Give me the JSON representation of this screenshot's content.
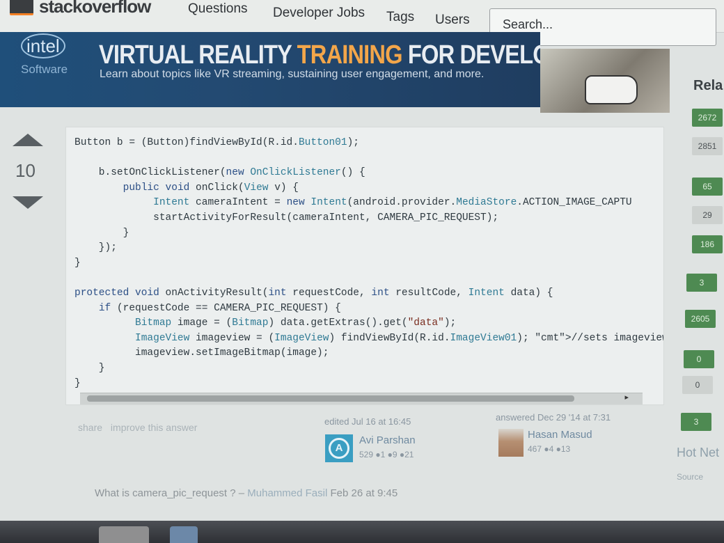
{
  "site": {
    "logo_text": "stackoverflow"
  },
  "nav": {
    "items": [
      "Questions",
      "Developer Jobs",
      "Tags",
      "Users"
    ],
    "search_placeholder": "Search..."
  },
  "banner": {
    "brand": "intel",
    "brand_sub": "Software",
    "title_part1": "VIRTUAL REALITY ",
    "title_accent": "TRAINING",
    "title_part2": " FOR DEVELOPERS",
    "subtitle": "Learn about topics like VR streaming, sustaining user engagement, and more."
  },
  "answer": {
    "vote_count": "10",
    "code_lines": [
      "Button b = (Button)findViewById(R.id.Button01);",
      "",
      "    b.setOnClickListener(new OnClickListener() {",
      "        public void onClick(View v) {",
      "             Intent cameraIntent = new Intent(android.provider.MediaStore.ACTION_IMAGE_CAPTU",
      "             startActivityForResult(cameraIntent, CAMERA_PIC_REQUEST);",
      "        }",
      "    });",
      "}",
      "",
      "protected void onActivityResult(int requestCode, int resultCode, Intent data) {",
      "    if (requestCode == CAMERA_PIC_REQUEST) {",
      "          Bitmap image = (Bitmap) data.getExtras().get(\"data\");",
      "          ImageView imageview = (ImageView) findViewById(R.id.ImageView01); //sets imageview",
      "          imageview.setImageBitmap(image);",
      "    }",
      "}"
    ],
    "share_label": "share",
    "improve_label": "improve this answer",
    "edited": {
      "action": "edited Jul 16 at 16:45",
      "user": "Avi Parshan",
      "rep": "529 ●1 ●9 ●21"
    },
    "answered": {
      "action": "answered Dec 29 '14 at 7:31",
      "user": "Hasan Masud",
      "rep": "467 ●4 ●13"
    },
    "comment": {
      "text": "What is camera_pic_request ? – ",
      "user": "Muhammed Fasil",
      "time": " Feb 26 at 9:45"
    }
  },
  "sidebar": {
    "title": "Rela",
    "related_scores": [
      {
        "score": "2672",
        "accepted": true
      },
      {
        "score": "2851",
        "accepted": false
      },
      {
        "score": "65",
        "accepted": true
      },
      {
        "score": "29",
        "accepted": false
      },
      {
        "score": "186",
        "accepted": true
      },
      {
        "score": "3",
        "accepted": true
      },
      {
        "score": "2605",
        "accepted": true
      },
      {
        "score": "0",
        "accepted": true
      },
      {
        "score": "0",
        "accepted": false
      },
      {
        "score": "3",
        "accepted": true
      }
    ],
    "hot_title": "Hot Net",
    "hot_item": "Source"
  }
}
